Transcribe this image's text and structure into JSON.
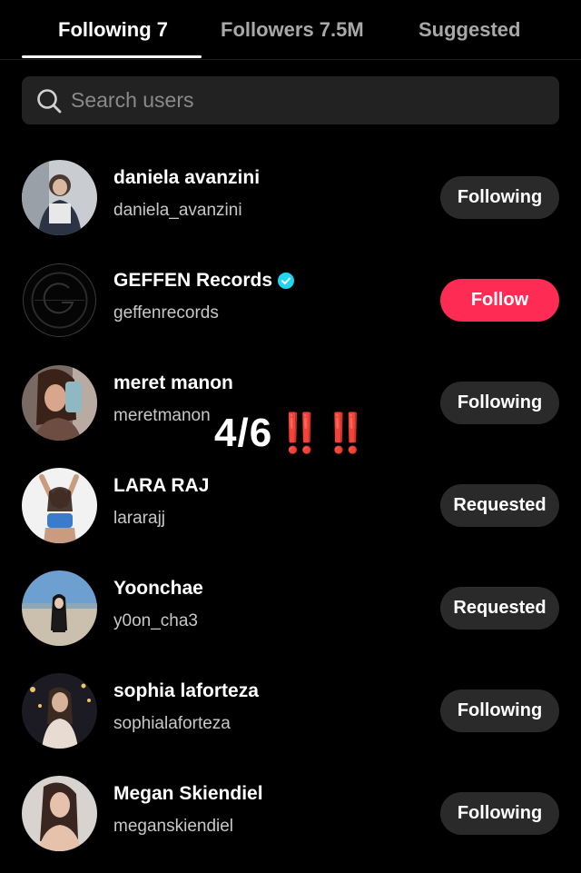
{
  "tabs": [
    {
      "label": "Following 7",
      "active": true
    },
    {
      "label": "Followers 7.5M",
      "active": false
    },
    {
      "label": "Suggested",
      "active": false
    }
  ],
  "search": {
    "placeholder": "Search users",
    "value": "",
    "icon": "search-icon"
  },
  "users": [
    {
      "name": "daniela avanzini",
      "handle": "daniela_avanzini",
      "button": "Following",
      "verified": false
    },
    {
      "name": "GEFFEN Records",
      "handle": "geffenrecords",
      "button": "Follow",
      "verified": true
    },
    {
      "name": "meret manon",
      "handle": "meretmanon",
      "button": "Following",
      "verified": false
    },
    {
      "name": "LARA RAJ",
      "handle": "lararajj",
      "button": "Requested",
      "verified": false
    },
    {
      "name": "Yoonchae",
      "handle": "y0on_cha3",
      "button": "Requested",
      "verified": false
    },
    {
      "name": "sophia laforteza",
      "handle": "sophialaforteza",
      "button": "Following",
      "verified": false
    },
    {
      "name": "Megan Skiendiel",
      "handle": "meganskiendiel",
      "button": "Following",
      "verified": false
    }
  ],
  "overlay": {
    "text": "4/6",
    "marks": "‼️‼️"
  },
  "colors": {
    "follow": "#fe2c55",
    "verified": "#20d5ec",
    "button_bg": "#2a2a2a",
    "background": "#000000"
  }
}
